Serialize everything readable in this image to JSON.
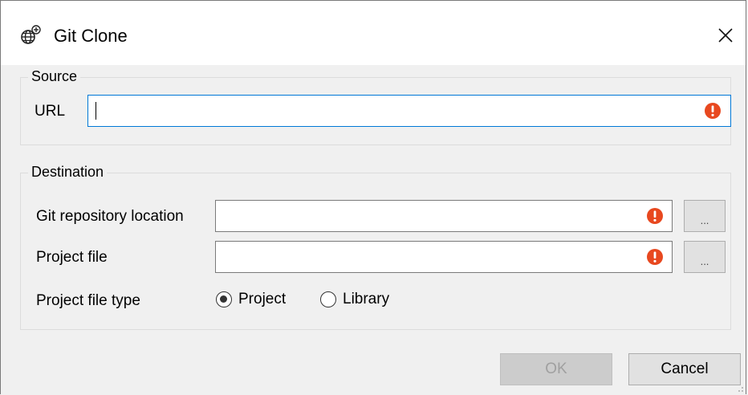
{
  "window": {
    "title": "Git Clone",
    "icon": "globe-git-icon",
    "close_icon": "close-icon"
  },
  "source": {
    "group_label": "Source",
    "url_label": "URL",
    "url_value": ""
  },
  "destination": {
    "group_label": "Destination",
    "repo_location_label": "Git repository location",
    "repo_location_value": "",
    "project_file_label": "Project file",
    "project_file_value": "",
    "browse_label": "...",
    "file_type_label": "Project file type",
    "file_type_options": [
      {
        "label": "Project",
        "selected": true
      },
      {
        "label": "Library",
        "selected": false
      }
    ]
  },
  "buttons": {
    "ok": "OK",
    "cancel": "Cancel",
    "ok_enabled": false
  },
  "colors": {
    "error": "#e8481f",
    "focus_border": "#0078d7"
  }
}
